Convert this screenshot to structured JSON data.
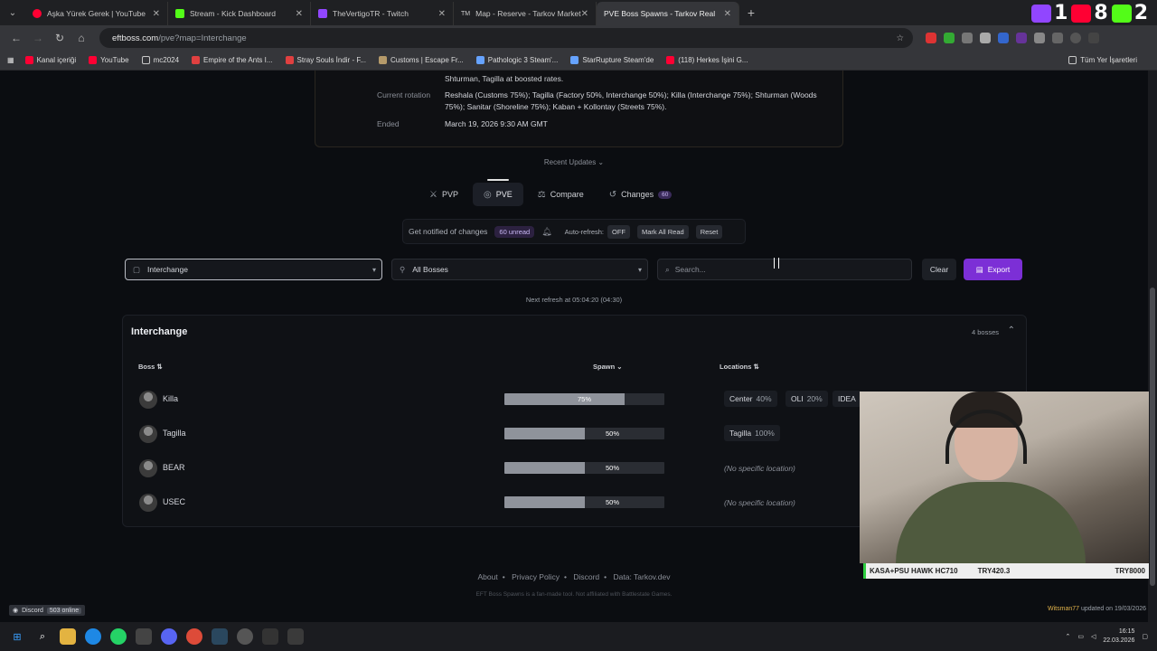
{
  "browser": {
    "tabs": [
      {
        "label": "Aşka Yürek Gerek | YouTube",
        "color": "#ff0033"
      },
      {
        "label": "Stream - Kick Dashboard",
        "color": "#53fc18"
      },
      {
        "label": "TheVertigoTR - Twitch",
        "color": "#9146ff"
      },
      {
        "label": "Map - Reserve - Tarkov Market",
        "color": "#c8c8c8"
      },
      {
        "label": "PVE Boss Spawns - Tarkov Real",
        "color": "#c8c8c8"
      }
    ],
    "tab_prefix_market": "TM",
    "url_host": "eftboss.com",
    "url_path": "/pve?map=Interchange",
    "bookmarks": [
      {
        "label": "Kanal içeriği",
        "color": "#ff0033"
      },
      {
        "label": "YouTube",
        "color": "#ff0033"
      },
      {
        "label": "mc2024",
        "color": "#c8c8c8"
      },
      {
        "label": "Empire of the Ants I...",
        "color": "#e04040"
      },
      {
        "label": "Stray Souls İndir - F...",
        "color": "#e04040"
      },
      {
        "label": "Customs | Escape Fr...",
        "color": "#b59a6a"
      },
      {
        "label": "Pathologic 3 Steam'...",
        "color": "#66a3ff"
      },
      {
        "label": "StarRupture Steam'de",
        "color": "#66a3ff"
      },
      {
        "label": "(118) Herkes İşini G...",
        "color": "#ff0033"
      }
    ],
    "bookmarks_right": "Tüm Yer İşaretleri",
    "overlay_counts": [
      "1",
      "8",
      "2"
    ]
  },
  "info_card": {
    "top_line": "Shturman, Tagilla at boosted rates.",
    "rows": [
      {
        "label": "Current rotation",
        "value": "Reshala (Customs 75%); Tagilla (Factory 50%, Interchange 50%); Killa (Interchange 75%); Shturman (Woods 75%); Sanitar (Shoreline 75%); Kaban + Kollontay (Streets 75%)."
      },
      {
        "label": "Ended",
        "value": "March 19, 2026 9:30 AM GMT"
      }
    ]
  },
  "recent_updates": "Recent Updates ⌄",
  "modes": [
    {
      "label": "PVP",
      "icon": "swords-icon"
    },
    {
      "label": "PVE",
      "icon": "shield-icon",
      "active": true
    },
    {
      "label": "Compare",
      "icon": "scale-icon"
    },
    {
      "label": "Changes",
      "icon": "history-icon",
      "count": "60"
    }
  ],
  "notify": {
    "text": "Get notified of changes",
    "unread": "60 unread",
    "auto_refresh_label": "Auto-refresh:",
    "auto_refresh_value": "OFF",
    "mark_all_read": "Mark All Read",
    "reset": "Reset"
  },
  "filters": {
    "map_select": "Interchange",
    "boss_select": "All Bosses",
    "search_placeholder": "Search...",
    "clear": "Clear",
    "export": "Export"
  },
  "next_refresh": "Next refresh at 05:04:20 (04:30)",
  "map_panel": {
    "title": "Interchange",
    "boss_count": "4 bosses",
    "columns": {
      "boss": "Boss ⇅",
      "spawn": "Spawn ⌄",
      "locations": "Locations ⇅"
    },
    "rows": [
      {
        "name": "Killa",
        "spawn_label": "75%",
        "spawn": 0.75,
        "locations": [
          {
            "name": "Center",
            "pct": "40%"
          },
          {
            "name": "OLI",
            "pct": "20%"
          },
          {
            "name": "IDEA",
            "pct": ""
          }
        ]
      },
      {
        "name": "Tagilla",
        "spawn_label": "50%",
        "spawn": 0.5,
        "locations": [
          {
            "name": "Tagilla",
            "pct": "100%"
          }
        ]
      },
      {
        "name": "BEAR",
        "spawn_label": "50%",
        "spawn": 0.5,
        "no_location": "(No specific location)"
      },
      {
        "name": "USEC",
        "spawn_label": "50%",
        "spawn": 0.5,
        "no_location": "(No specific location)"
      }
    ]
  },
  "footer": {
    "links": [
      "About",
      "Privacy Policy",
      "Discord",
      "Data: Tarkov.dev"
    ],
    "note": "EFT Boss Spawns is a fan-made tool. Not affiliated with Battlestate Games.",
    "discord_label": "Discord",
    "discord_online": "503 online",
    "updated_user": "Witsman77",
    "updated_text": "updated on 19/03/2026"
  },
  "ticker": {
    "items": [
      "KASA+PSU HAWK HC710",
      "TRY420.3",
      "TRY8000"
    ]
  },
  "taskbar": {
    "time": "16:15",
    "date": "22.03.2026"
  }
}
